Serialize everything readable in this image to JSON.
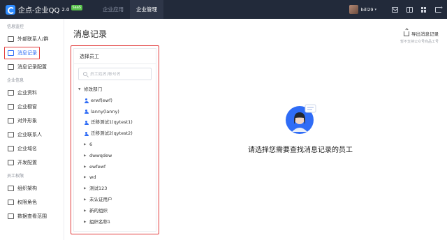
{
  "app": {
    "logo_text": "企点-企业QQ",
    "version": "2.0",
    "badge": "SaaS"
  },
  "topnav": [
    {
      "label": "企业应用",
      "active": false
    },
    {
      "label": "企业管理",
      "active": true
    }
  ],
  "user": {
    "name": "bill29",
    "caret": "▾"
  },
  "sidebar": {
    "groups": [
      {
        "title": "信息监控",
        "items": [
          {
            "label": "外部联系人/群",
            "icon": "contacts-icon",
            "active": false
          },
          {
            "label": "消息记录",
            "icon": "message-record-icon",
            "active": true
          },
          {
            "label": "消息记录配置",
            "icon": "message-config-icon",
            "active": false
          }
        ]
      },
      {
        "title": "企业信息",
        "items": [
          {
            "label": "企业资料",
            "icon": "company-profile-icon",
            "active": false
          },
          {
            "label": "企业橱窗",
            "icon": "showcase-icon",
            "active": false
          },
          {
            "label": "对外形象",
            "icon": "image-icon",
            "active": false
          },
          {
            "label": "企业联系人",
            "icon": "company-contact-icon",
            "active": false
          },
          {
            "label": "企业域名",
            "icon": "domain-icon",
            "active": false
          },
          {
            "label": "开发配置",
            "icon": "dev-config-icon",
            "active": false
          }
        ]
      },
      {
        "title": "员工权限",
        "items": [
          {
            "label": "组织架构",
            "icon": "org-icon",
            "active": false
          },
          {
            "label": "权限角色",
            "icon": "role-icon",
            "active": false
          },
          {
            "label": "数据查看范围",
            "icon": "data-scope-icon",
            "active": false
          }
        ]
      }
    ]
  },
  "main": {
    "title": "消息记录",
    "export_label": "导出消息记录",
    "export_note": "暂不支持公众号商品工号"
  },
  "panel": {
    "title": "选择员工",
    "search_placeholder": "员工姓名/帐号名",
    "tree": [
      {
        "label": "修改部门",
        "level": 0,
        "expanded": true,
        "type": "dept"
      },
      {
        "label": "erwf(ewf)",
        "level": 1,
        "type": "person"
      },
      {
        "label": "lanny(lanny)",
        "level": 1,
        "type": "person"
      },
      {
        "label": "迁移测试1(qytest1)",
        "level": 1,
        "type": "person"
      },
      {
        "label": "迁移测试2(qytest2)",
        "level": 1,
        "type": "person"
      },
      {
        "label": "6",
        "level": 1,
        "type": "dept"
      },
      {
        "label": "dwwqdew",
        "level": 1,
        "type": "dept"
      },
      {
        "label": "ewfewf",
        "level": 1,
        "type": "dept"
      },
      {
        "label": "wd",
        "level": 1,
        "type": "dept"
      },
      {
        "label": "测试123",
        "level": 1,
        "type": "dept"
      },
      {
        "label": "未认证用户",
        "level": 1,
        "type": "dept"
      },
      {
        "label": "新的组织",
        "level": 1,
        "type": "dept"
      },
      {
        "label": "组织名称1",
        "level": 1,
        "type": "dept"
      }
    ]
  },
  "empty_state": {
    "text": "请选择您需要查找消息记录的员工"
  },
  "colors": {
    "topbar": "#222a3a",
    "accent": "#2f6cf6",
    "highlight": "#e23b3b"
  }
}
